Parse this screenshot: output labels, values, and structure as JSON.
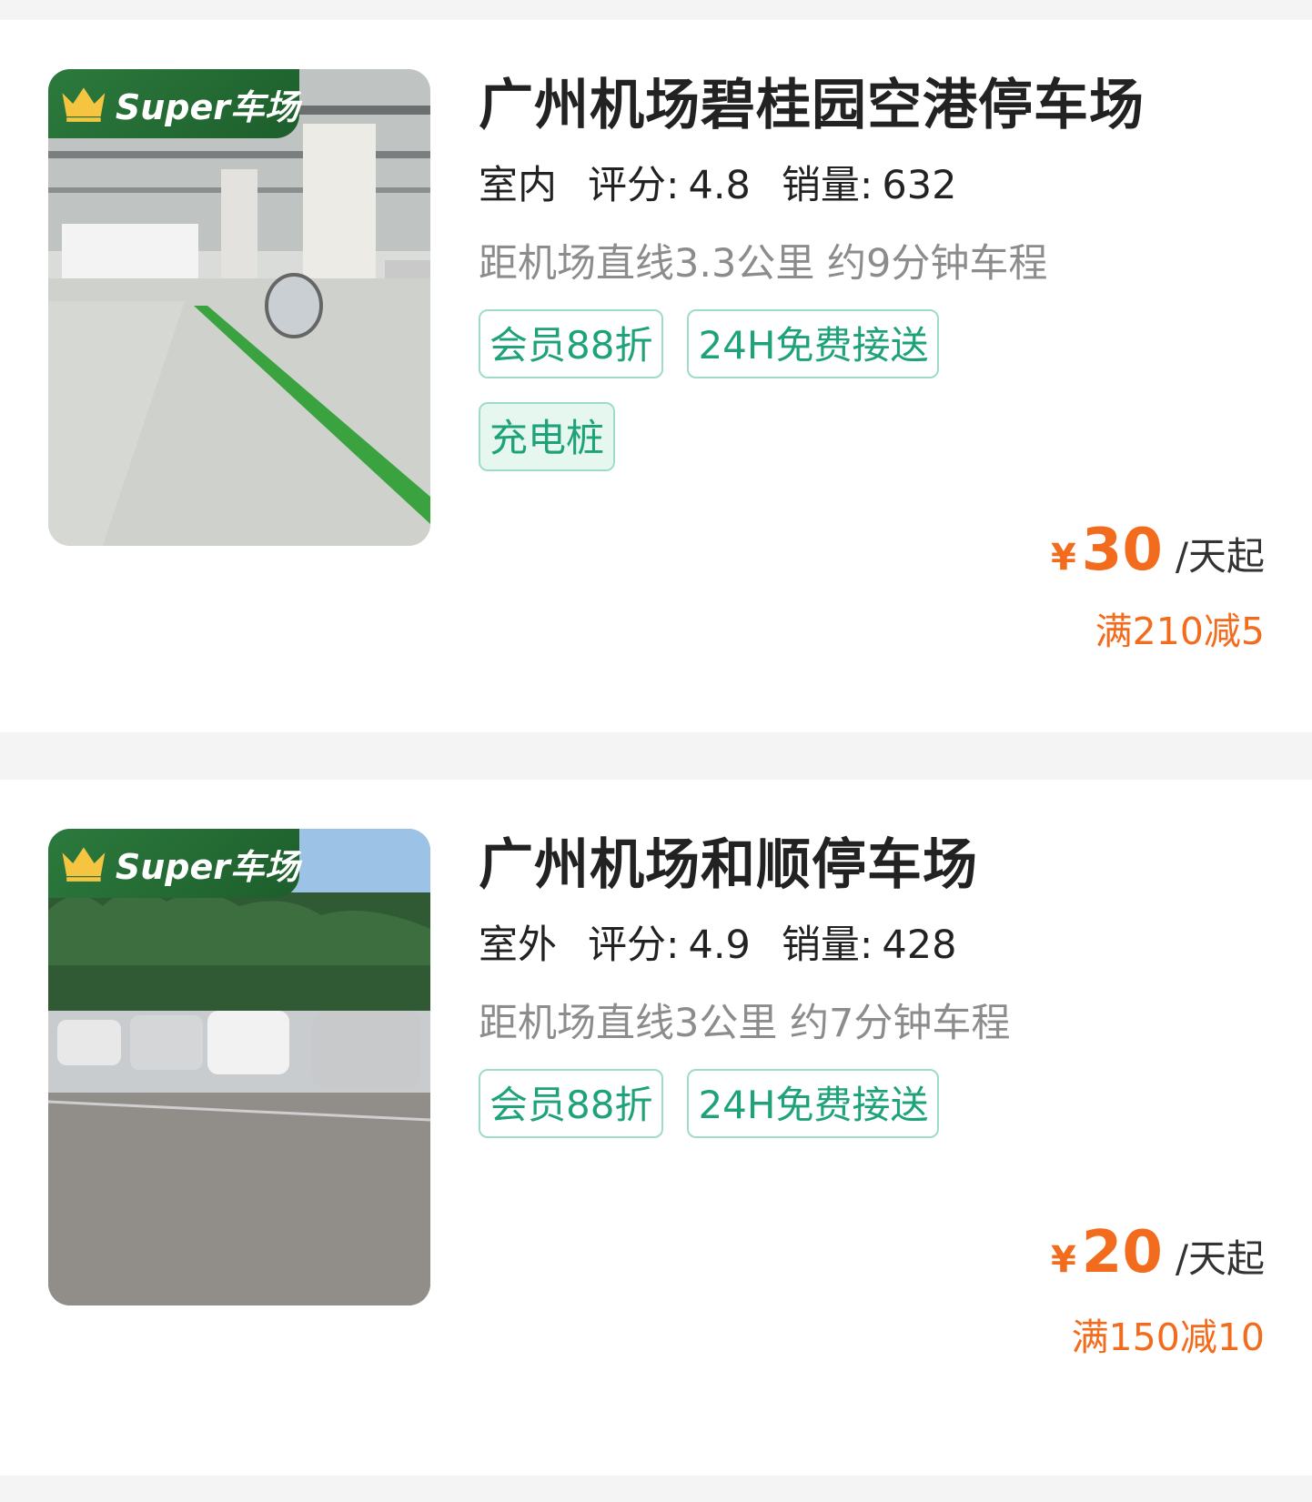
{
  "lots": [
    {
      "badge": "Super车场",
      "name": "广州机场碧桂园空港停车场",
      "type": "室内",
      "rating_label": "评分:",
      "rating": "4.8",
      "sales_label": "销量:",
      "sales": "632",
      "distance": "距机场直线3.3公里 约9分钟车程",
      "tags": [
        "会员88折",
        "24H免费接送",
        "充电桩"
      ],
      "currency": "¥",
      "price": "30",
      "price_unit": "/天起",
      "promo": "满210减5",
      "image": "indoor-parking-garage-photo"
    },
    {
      "badge": "Super车场",
      "name": "广州机场和顺停车场",
      "type": "室外",
      "rating_label": "评分:",
      "rating": "4.9",
      "sales_label": "销量:",
      "sales": "428",
      "distance": "距机场直线3公里 约7分钟车程",
      "tags": [
        "会员88折",
        "24H免费接送"
      ],
      "currency": "¥",
      "price": "20",
      "price_unit": "/天起",
      "promo": "满150减10",
      "image": "outdoor-parking-lot-photo"
    }
  ],
  "colors": {
    "accent_green": "#1ea27a",
    "price_orange": "#f36b1c",
    "badge_green": "#2c7a3d"
  },
  "icons": {
    "badge_icon": "crown-icon"
  }
}
